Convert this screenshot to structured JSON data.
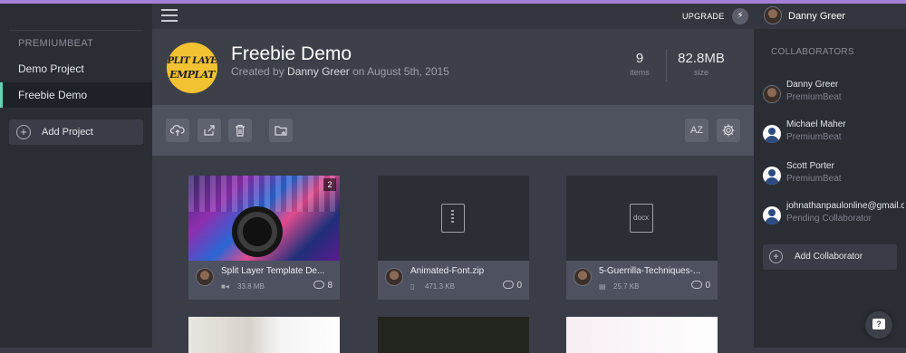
{
  "workspace": {
    "label": "PREMIUMBEAT"
  },
  "projects": [
    {
      "label": "Demo Project"
    },
    {
      "label": "Freebie Demo"
    }
  ],
  "sidebar": {
    "add_project": "Add Project"
  },
  "topbar": {
    "upgrade": "UPGRADE",
    "user_name": "Danny Greer"
  },
  "project": {
    "logo_line1": "PLIT LAYE",
    "logo_line2": "EMPLAT",
    "title": "Freebie Demo",
    "created_prefix": "Created by",
    "created_by": "Danny Greer",
    "created_on": "on August 5th, 2015",
    "items_count": "9",
    "items_label": "items",
    "size_value": "82.8MB",
    "size_label": "size"
  },
  "toolbar": {
    "sort_label": "AZ"
  },
  "files": [
    {
      "name": "Split Layer Template De...",
      "size": "33.8 MB",
      "comments": "8",
      "version": "2",
      "type_icon": "video-icon"
    },
    {
      "name": "Animated-Font.zip",
      "size": "471.3 KB",
      "comments": "0",
      "type_icon": "zip-icon"
    },
    {
      "name": "5-Guerrilla-Techniques-...",
      "size": "25.7 KB",
      "comments": "0",
      "type_icon": "doc-icon",
      "ext": "docx"
    }
  ],
  "collaborators_panel": {
    "heading": "COLLABORATORS",
    "items": [
      {
        "name": "Danny Greer",
        "org": "PremiumBeat"
      },
      {
        "name": "Michael Maher",
        "org": "PremiumBeat"
      },
      {
        "name": "Scott Porter",
        "org": "PremiumBeat"
      },
      {
        "name": "johnathanpaulonline@gmail.co",
        "org": "Pending Collaborator"
      }
    ],
    "add_label": "Add Collaborator"
  },
  "colors": {
    "accent_top": "#a57fd6",
    "active_project": "#5fd5b5",
    "logo_yellow": "#f2c232"
  }
}
